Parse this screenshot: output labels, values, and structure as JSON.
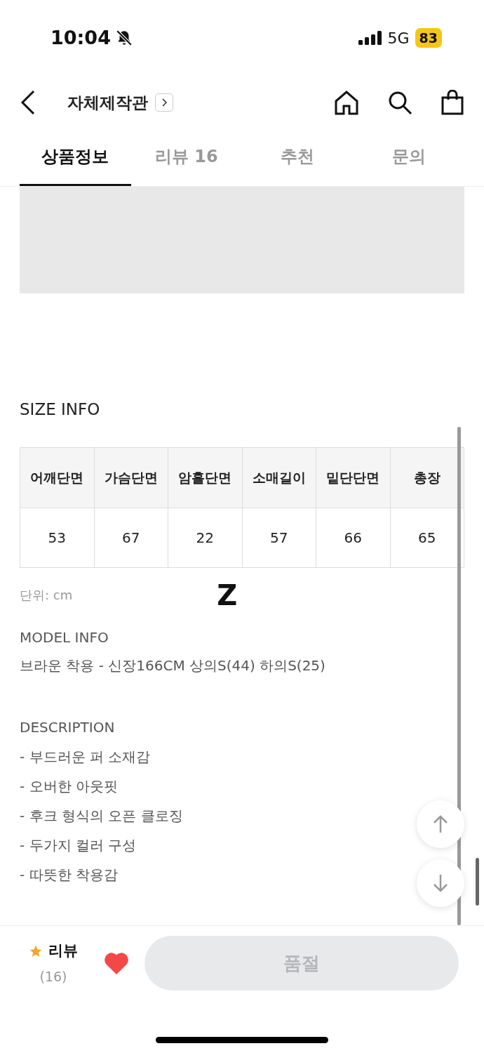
{
  "status_bar": {
    "time": "10:04",
    "network": "5G",
    "battery": "83"
  },
  "header": {
    "title": "자체제작관"
  },
  "tabs": [
    {
      "label": "상품정보",
      "selected": true
    },
    {
      "label": "리뷰 16",
      "selected": false
    },
    {
      "label": "추천",
      "selected": false
    },
    {
      "label": "문의",
      "selected": false
    }
  ],
  "size_info": {
    "title": "SIZE INFO",
    "columns": [
      "어깨단면",
      "가슴단면",
      "암홀단면",
      "소매길이",
      "밑단단면",
      "총장"
    ],
    "values": [
      "53",
      "67",
      "22",
      "57",
      "66",
      "65"
    ],
    "unit": "단위: cm",
    "mark": "Z"
  },
  "model_info": {
    "title": "MODEL INFO",
    "text": "브라운 착용 - 신장166CM 상의S(44) 하의S(25)"
  },
  "description": {
    "title": "DESCRIPTION",
    "items": [
      "- 부드러운 퍼 소재감",
      "- 오버한 아웃핏",
      "- 후크 형식의 오픈 클로징",
      "- 두가지 컬러 구성",
      "- 따뜻한 착용감"
    ]
  },
  "bottom_bar": {
    "review_label": "리뷰",
    "review_count": "(16)",
    "liked": true,
    "buy_button": {
      "label": "품절",
      "disabled": true
    }
  }
}
